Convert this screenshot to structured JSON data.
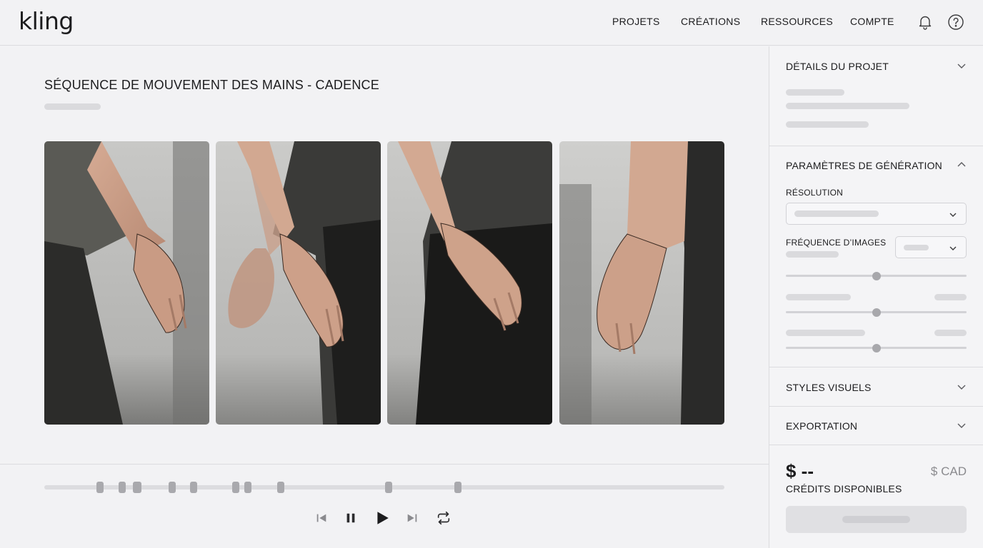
{
  "app": {
    "logo": "kling"
  },
  "nav": {
    "projects": "PROJETS",
    "creations": "CRÉATIONS",
    "resources": "RESSOURCES",
    "account": "COMPTE"
  },
  "main": {
    "title": "SÉQUENCE DE MOUVEMENT DES MAINS - CADENCE",
    "frame_count": 4
  },
  "sidebar": {
    "details": {
      "title": "DÉTAILS DU PROJET",
      "expanded": false
    },
    "generation": {
      "title": "PARAMÈTRES DE GÉNÉRATION",
      "expanded": true,
      "resolution_label": "RÉSOLUTION",
      "frame_rate_label": "FRÉQUENCE D’IMAGES",
      "sliders": [
        0.5,
        0.5,
        0.5
      ]
    },
    "styles": {
      "title": "STYLES VISUELS",
      "expanded": false
    },
    "export": {
      "title": "EXPORTATION",
      "expanded": false
    },
    "price": "$ --",
    "currency": "$ CAD",
    "credits_label": "CRÉDITS DISPONIBLES"
  },
  "colors": {
    "background": "#f2f2f4",
    "text": "#1c1c1e",
    "skeleton": "#dadadd",
    "keyframe": "#a9a9ad"
  },
  "icons": {
    "notifications": "bell-icon",
    "help": "help-icon",
    "skip_back": "skip-back-icon",
    "pause": "pause-icon",
    "play": "play-icon",
    "skip_forward": "skip-forward-icon",
    "loop": "loop-icon"
  }
}
